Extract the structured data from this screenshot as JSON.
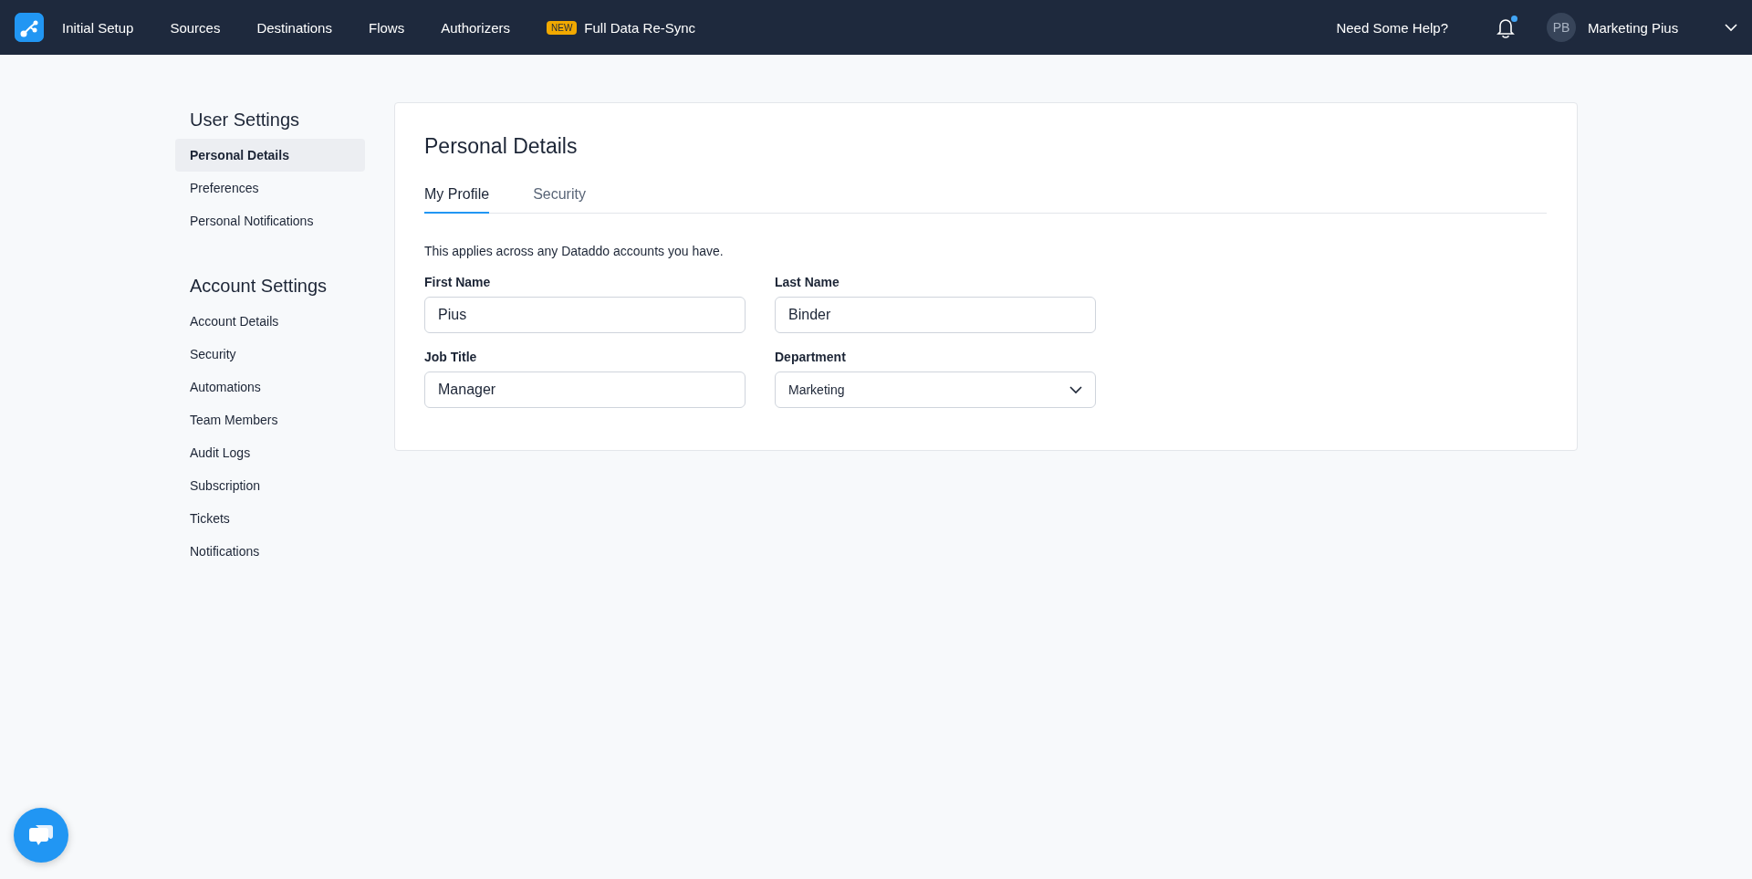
{
  "topbar": {
    "nav": [
      {
        "label": "Initial Setup"
      },
      {
        "label": "Sources"
      },
      {
        "label": "Destinations"
      },
      {
        "label": "Flows"
      },
      {
        "label": "Authorizers"
      },
      {
        "label": "Full Data Re-Sync",
        "badge": "NEW"
      }
    ],
    "help": "Need Some Help?",
    "notifications": {
      "unread": true
    },
    "user": {
      "initials": "PB",
      "name": "Marketing Pius"
    }
  },
  "sidebar": {
    "sections": [
      {
        "title": "User Settings",
        "items": [
          {
            "label": "Personal Details",
            "selected": true
          },
          {
            "label": "Preferences",
            "selected": false
          },
          {
            "label": "Personal Notifications",
            "selected": false
          }
        ]
      },
      {
        "title": "Account Settings",
        "items": [
          {
            "label": "Account Details",
            "selected": false
          },
          {
            "label": "Security",
            "selected": false
          },
          {
            "label": "Automations",
            "selected": false
          },
          {
            "label": "Team Members",
            "selected": false
          },
          {
            "label": "Audit Logs",
            "selected": false
          },
          {
            "label": "Subscription",
            "selected": false
          },
          {
            "label": "Tickets",
            "selected": false
          },
          {
            "label": "Notifications",
            "selected": false
          }
        ]
      }
    ]
  },
  "card": {
    "title": "Personal Details",
    "tabs": [
      {
        "label": "My Profile",
        "selected": true
      },
      {
        "label": "Security",
        "selected": false
      }
    ],
    "description": "This applies across any Dataddo accounts you have.",
    "fields": [
      {
        "label": "First Name",
        "value": "Pius",
        "kind": "text"
      },
      {
        "label": "Last Name",
        "value": "Binder",
        "kind": "text"
      },
      {
        "label": "Job Title",
        "value": "Manager",
        "kind": "text"
      },
      {
        "label": "Department",
        "value": "Marketing",
        "kind": "select"
      }
    ]
  }
}
